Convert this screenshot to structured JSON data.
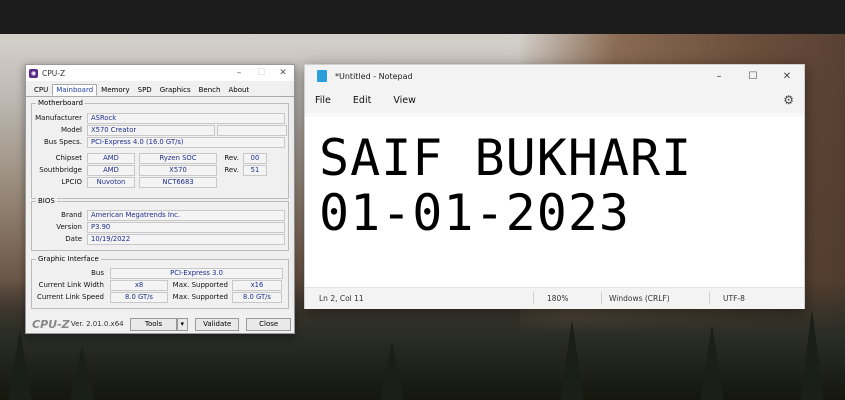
{
  "cpuz": {
    "title": "CPU-Z",
    "tabs": [
      "CPU",
      "Mainboard",
      "Memory",
      "SPD",
      "Graphics",
      "Bench",
      "About"
    ],
    "active_tab": "Mainboard",
    "motherboard": {
      "group": "Motherboard",
      "manufacturer_label": "Manufacturer",
      "manufacturer": "ASRock",
      "model_label": "Model",
      "model": "X570 Creator",
      "bus_label": "Bus Specs.",
      "bus": "PCI-Express 4.0 (16.0 GT/s)",
      "chipset_label": "Chipset",
      "chipset_vendor": "AMD",
      "chipset_name": "Ryzen SOC",
      "chipset_rev_label": "Rev.",
      "chipset_rev": "00",
      "southbridge_label": "Southbridge",
      "southbridge_vendor": "AMD",
      "southbridge_name": "X570",
      "southbridge_rev_label": "Rev.",
      "southbridge_rev": "51",
      "lpcio_label": "LPCIO",
      "lpcio_vendor": "Nuvoton",
      "lpcio_name": "NCT6683"
    },
    "bios": {
      "group": "BIOS",
      "brand_label": "Brand",
      "brand": "American Megatrends Inc.",
      "version_label": "Version",
      "version": "P3.90",
      "date_label": "Date",
      "date": "10/19/2022"
    },
    "graphic": {
      "group": "Graphic Interface",
      "bus_label": "Bus",
      "bus": "PCI-Express 3.0",
      "link_width_label": "Current Link Width",
      "link_width": "x8",
      "max_width_label": "Max. Supported",
      "max_width": "x16",
      "link_speed_label": "Current Link Speed",
      "link_speed": "8.0 GT/s",
      "max_speed_label": "Max. Supported",
      "max_speed": "8.0 GT/s"
    },
    "brand": "CPU-Z",
    "version": "Ver. 2.01.0.x64",
    "tools_label": "Tools",
    "validate_label": "Validate",
    "close_label": "Close"
  },
  "notepad": {
    "title": "*Untitled - Notepad",
    "menu": [
      "File",
      "Edit",
      "View"
    ],
    "lines": [
      "SAIF BUKHARI",
      "01-01-2023"
    ],
    "status": {
      "position": "Ln 2, Col 11",
      "zoom": "180%",
      "line_ending": "Windows (CRLF)",
      "encoding": "UTF-8"
    }
  }
}
